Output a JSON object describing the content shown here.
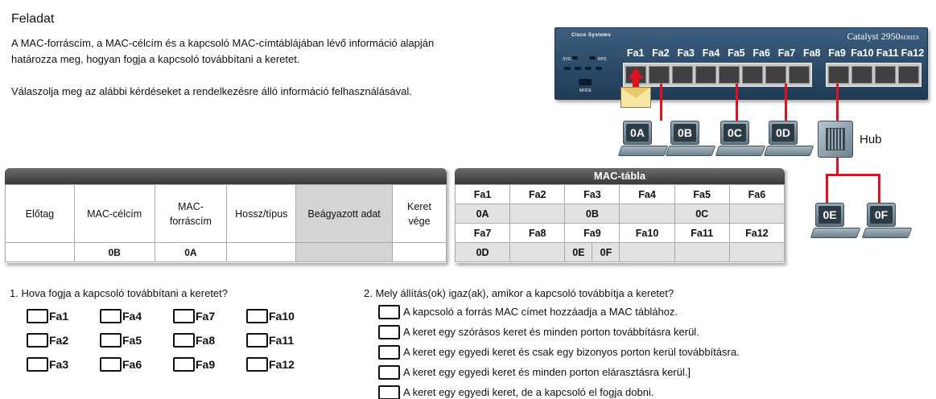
{
  "title": "Feladat",
  "intro": {
    "p1": "A MAC-forráscím, a MAC-célcím és a kapcsoló MAC-címtáblájában lévő információ alapján határozza meg, hogyan fogja a kapcsoló továbbítani a keretet.",
    "p2": "Válaszolja meg az alábbi kérdéseket a rendelkezésre álló információ felhasználásával."
  },
  "frame": {
    "headers": [
      "Előtag",
      "MAC-célcím",
      "MAC-\nforráscím",
      "Hossz/típus",
      "Beágyazott adat",
      "Keret vége"
    ],
    "values": [
      "",
      "0B",
      "0A",
      "",
      "",
      ""
    ]
  },
  "mac_table": {
    "title": "MAC-tábla",
    "row1_ports": [
      "Fa1",
      "Fa2",
      "Fa3",
      "Fa4",
      "Fa5",
      "Fa6"
    ],
    "row1_addrs": [
      "0A",
      "",
      "0B",
      "",
      "0C",
      ""
    ],
    "row2_ports": [
      "Fa7",
      "Fa8",
      "Fa9",
      "Fa10",
      "Fa11",
      "Fa12"
    ],
    "row2_addrs": [
      "0D",
      "",
      "0E",
      "",
      "",
      ""
    ],
    "row2_fa9_second": "0F"
  },
  "switch": {
    "brand": "Cisco Systems",
    "model": "Catalyst 2950",
    "series": "SERIES",
    "ports": [
      "Fa1",
      "Fa2",
      "Fa3",
      "Fa4",
      "Fa5",
      "Fa6",
      "Fa7",
      "Fa8",
      "Fa9",
      "Fa10",
      "Fa11",
      "Fa12"
    ],
    "syst": "SYST",
    "rps": "RPS",
    "mode": "MODE"
  },
  "hosts": [
    "0A",
    "0B",
    "0C",
    "0D",
    "0E",
    "0F"
  ],
  "hub_label": "Hub",
  "q1": {
    "text": "1. Hova fogja a kapcsoló továbbítani a keretet?",
    "options": [
      "Fa1",
      "Fa4",
      "Fa7",
      "Fa10",
      "Fa2",
      "Fa5",
      "Fa8",
      "Fa11",
      "Fa3",
      "Fa6",
      "Fa9",
      "Fa12"
    ]
  },
  "q2": {
    "text": "2. Mely állítás(ok) igaz(ak), amikor a kapcsoló továbbítja a keretet?",
    "statements": [
      "A kapcsoló a forrás MAC címet hozzáadja a MAC táblához.",
      "A keret egy szórásos keret és minden porton továbbításra kerül.",
      "A keret egy egyedi keret és csak egy bizonyos porton kerül továbbításra.",
      "A keret egy egyedi keret és minden porton elárasztásra kerül.]",
      "A keret egy egyedi keret, de a kapcsoló el fogja dobni."
    ]
  }
}
